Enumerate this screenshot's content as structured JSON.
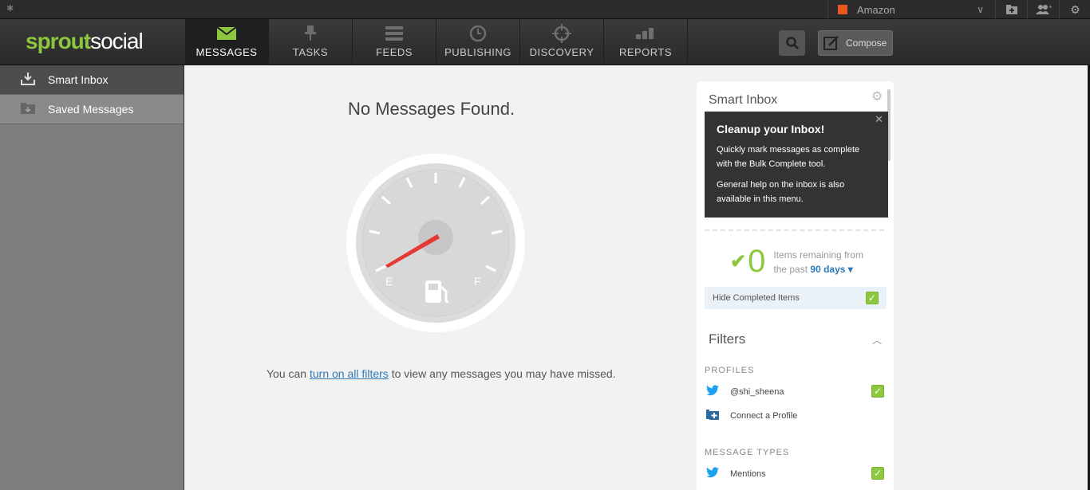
{
  "top_strip": {
    "account_name": "Amazon",
    "icons": [
      "pin-icon",
      "add-folder-icon",
      "add-user-icon",
      "settings-icon"
    ]
  },
  "header": {
    "logo_part1": "sprout",
    "logo_part2": "social",
    "nav": [
      {
        "label": "MESSAGES",
        "icon": "envelope-icon",
        "active": true
      },
      {
        "label": "TASKS",
        "icon": "pin-icon",
        "active": false
      },
      {
        "label": "FEEDS",
        "icon": "list-icon",
        "active": false
      },
      {
        "label": "PUBLISHING",
        "icon": "clock-icon",
        "active": false
      },
      {
        "label": "DISCOVERY",
        "icon": "crosshair-icon",
        "active": false
      },
      {
        "label": "REPORTS",
        "icon": "bar-chart-icon",
        "active": false
      }
    ],
    "compose_label": "Compose"
  },
  "sidebar": {
    "items": [
      {
        "label": "Smart Inbox",
        "icon": "inbox-icon"
      },
      {
        "label": "Saved Messages",
        "icon": "saved-folder-icon"
      }
    ]
  },
  "main": {
    "heading": "No Messages Found.",
    "gauge_empty_label": "E",
    "gauge_full_label": "F",
    "hint_before": "You can ",
    "hint_link": "turn on all filters",
    "hint_after": " to view any messages you may have missed."
  },
  "panel": {
    "title": "Smart Inbox",
    "tooltip": {
      "title": "Cleanup your Inbox!",
      "para1": "Quickly mark messages as complete with the Bulk Complete tool.",
      "para2": "General help on the inbox is also available in this menu."
    },
    "remaining_count": "0",
    "remaining_line1": "Items remaining from",
    "remaining_line2": "the past",
    "remaining_period": "90 days",
    "hide_completed": "Hide Completed Items",
    "filters_title": "Filters",
    "profiles_label": "PROFILES",
    "profile_name": "@shi_sheena",
    "connect_profile": "Connect a Profile",
    "message_types_label": "MESSAGE TYPES",
    "mentions": "Mentions"
  },
  "colors": {
    "accent_green": "#8dc63f",
    "link_blue": "#2e78b7",
    "needle_red": "#e53935"
  }
}
